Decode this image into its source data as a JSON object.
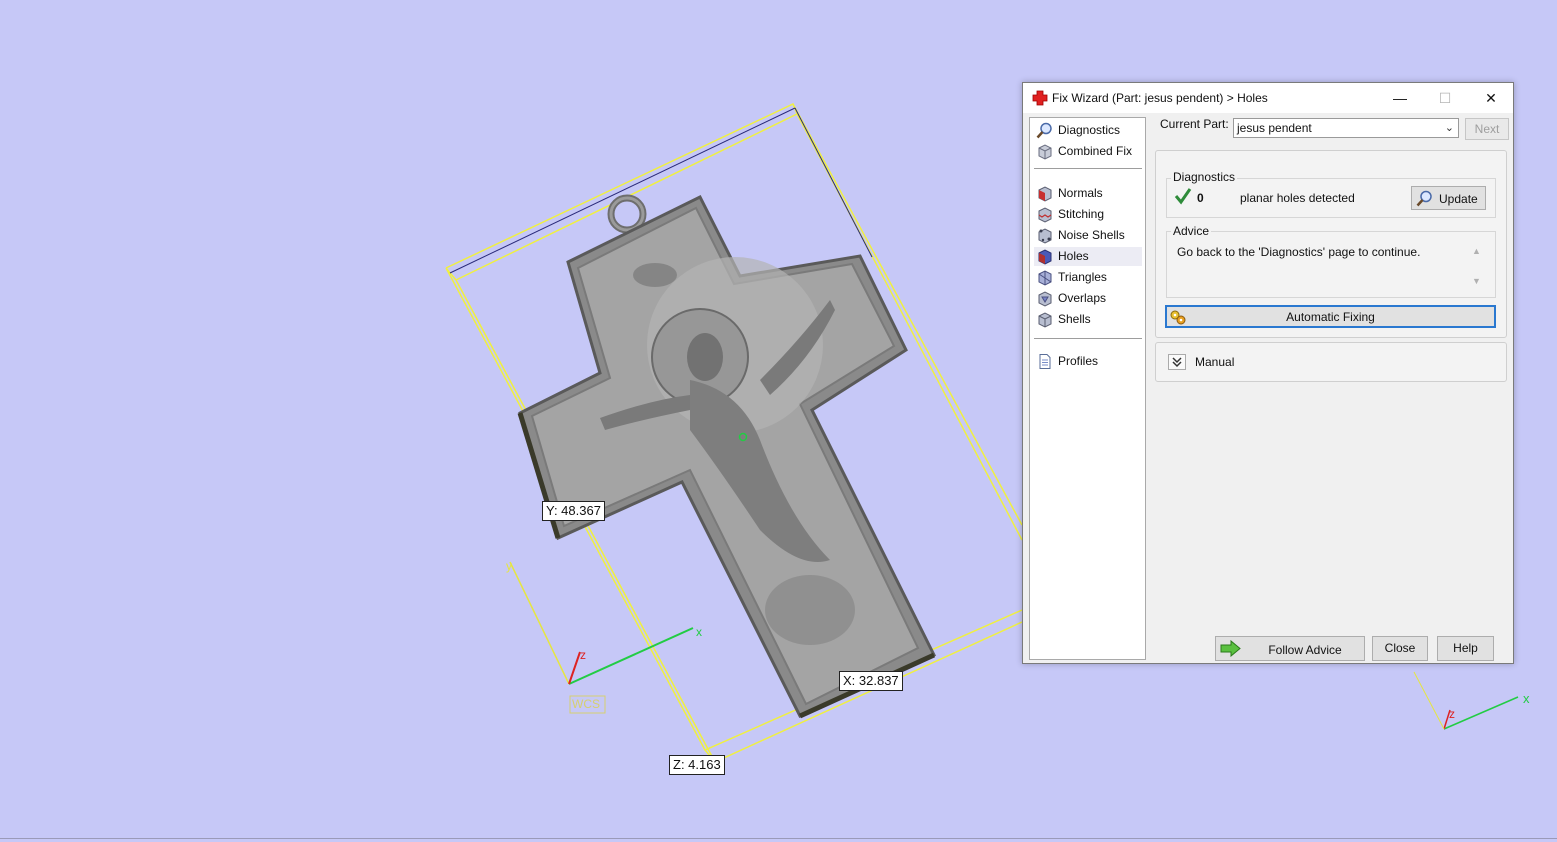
{
  "viewport": {
    "dimensions": {
      "y": "Y: 48.367",
      "x": "X: 32.837",
      "z": "Z: 4.163"
    },
    "axis_labels": {
      "x": "x",
      "y": "y",
      "z": "z"
    },
    "wcs_label": "WCS",
    "colors": {
      "background": "#c6c8f7",
      "bounding_box": "#f0f040",
      "x_axis": "#22cc44",
      "y_axis": "#e6e640",
      "z_axis": "#dd2222"
    }
  },
  "dialog": {
    "title": "Fix Wizard (Part: jesus pendent) > Holes",
    "window_controls": {
      "minimize": "—",
      "maximize": "☐",
      "close": "✕"
    },
    "nav": {
      "items_top": [
        {
          "label": "Diagnostics",
          "icon": "magnifier-icon"
        },
        {
          "label": "Combined Fix",
          "icon": "cube-icon"
        }
      ],
      "items_fix": [
        {
          "label": "Normals",
          "icon": "normals-cube-icon"
        },
        {
          "label": "Stitching",
          "icon": "stitching-cube-icon"
        },
        {
          "label": "Noise Shells",
          "icon": "noise-shells-icon"
        },
        {
          "label": "Holes",
          "icon": "holes-cube-icon",
          "selected": true
        },
        {
          "label": "Triangles",
          "icon": "triangles-icon"
        },
        {
          "label": "Overlaps",
          "icon": "overlaps-icon"
        },
        {
          "label": "Shells",
          "icon": "shells-icon"
        }
      ],
      "items_bottom": [
        {
          "label": "Profiles",
          "icon": "document-icon"
        }
      ]
    },
    "current_part": {
      "label": "Current Part:",
      "value": "jesus pendent"
    },
    "next_button": "Next",
    "diagnostics": {
      "title": "Diagnostics",
      "count": "0",
      "message": "planar holes detected",
      "update_button": "Update"
    },
    "advice": {
      "title": "Advice",
      "text": "Go back to the 'Diagnostics' page to continue."
    },
    "automatic_fixing_button": "Automatic Fixing",
    "manual_label": "Manual",
    "footer": {
      "follow_advice": "Follow Advice",
      "close": "Close",
      "help": "Help"
    }
  }
}
